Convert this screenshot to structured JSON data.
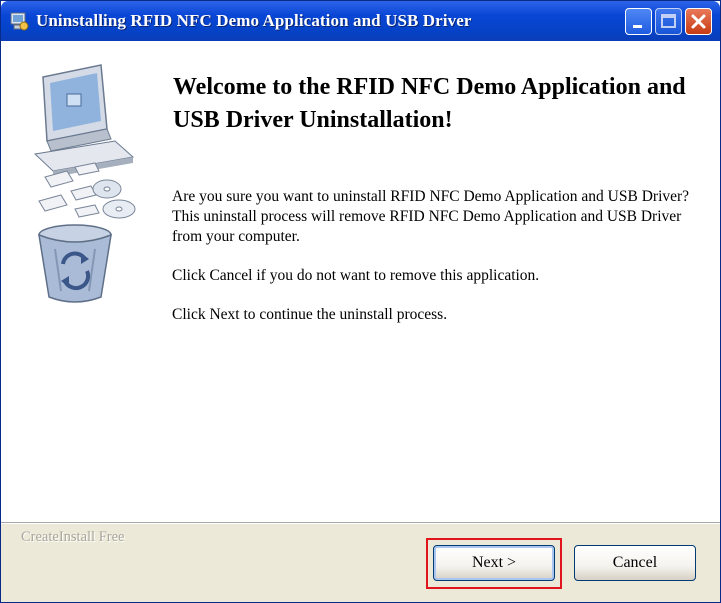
{
  "window": {
    "title": "Uninstalling RFID NFC Demo Application and USB Driver"
  },
  "titlebar_buttons": [
    "minimize",
    "maximize",
    "close"
  ],
  "main": {
    "heading": "Welcome to the RFID NFC Demo Application and USB Driver Uninstallation!",
    "body": {
      "line1": "Are you sure you want to uninstall RFID NFC Demo Application and USB Driver?",
      "line2": "This uninstall process will remove RFID NFC Demo Application and USB Driver from your computer.",
      "line3": "Click Cancel if you do not want to remove this application.",
      "line4": "Click Next to continue the uninstall process."
    }
  },
  "footer": {
    "brand": "CreateInstall Free",
    "next_label": "Next >",
    "cancel_label": "Cancel"
  },
  "colors": {
    "titlebar": "#0543c9",
    "highlight": "#e0141a",
    "footer_bg": "#ece9d8"
  }
}
